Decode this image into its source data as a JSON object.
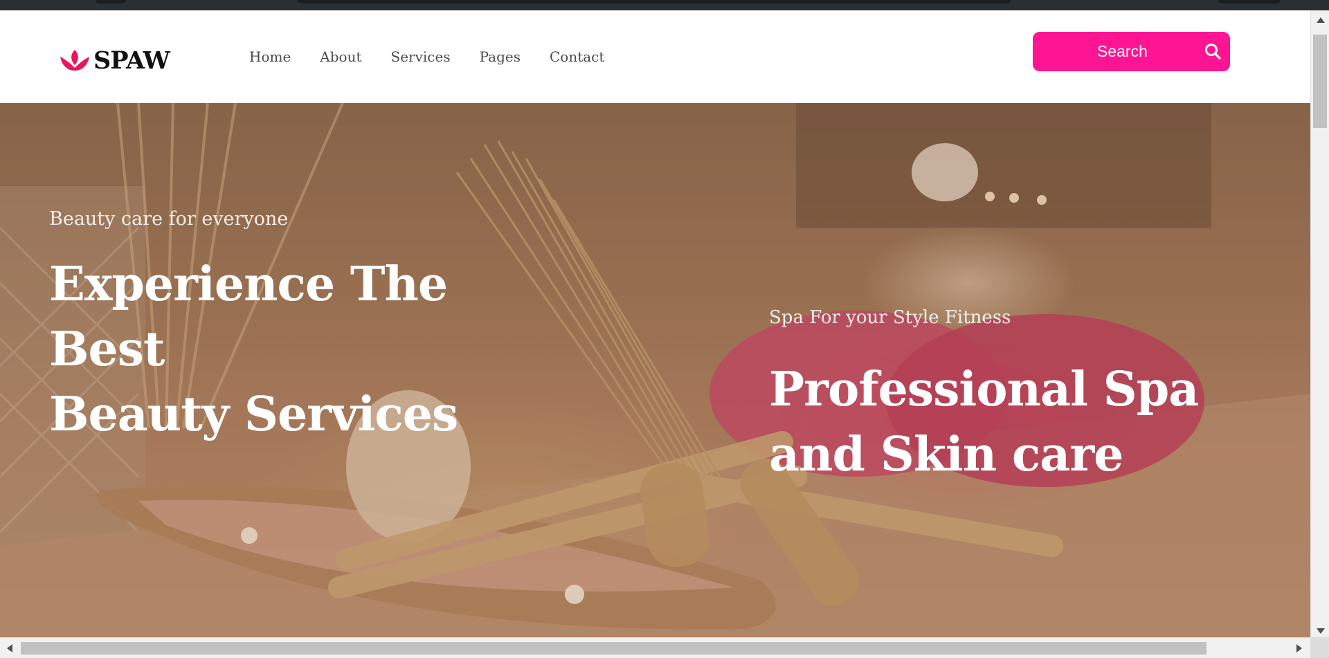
{
  "brand": {
    "name": "SPAW",
    "accent_color": "#ff1493",
    "logo_icon": "lotus-icon"
  },
  "nav": {
    "items": [
      {
        "label": "Home"
      },
      {
        "label": "About"
      },
      {
        "label": "Services"
      },
      {
        "label": "Pages"
      },
      {
        "label": "Contact"
      }
    ]
  },
  "search": {
    "label": "Search",
    "icon": "search-icon"
  },
  "hero": {
    "left": {
      "kicker": "Beauty care for everyone",
      "headline_line1": "Experience The Best",
      "headline_line2": "Beauty Services"
    },
    "right": {
      "kicker": "Spa For your Style Fitness",
      "headline_line1": "Professional Spa",
      "headline_line2": "and Skin care"
    }
  }
}
